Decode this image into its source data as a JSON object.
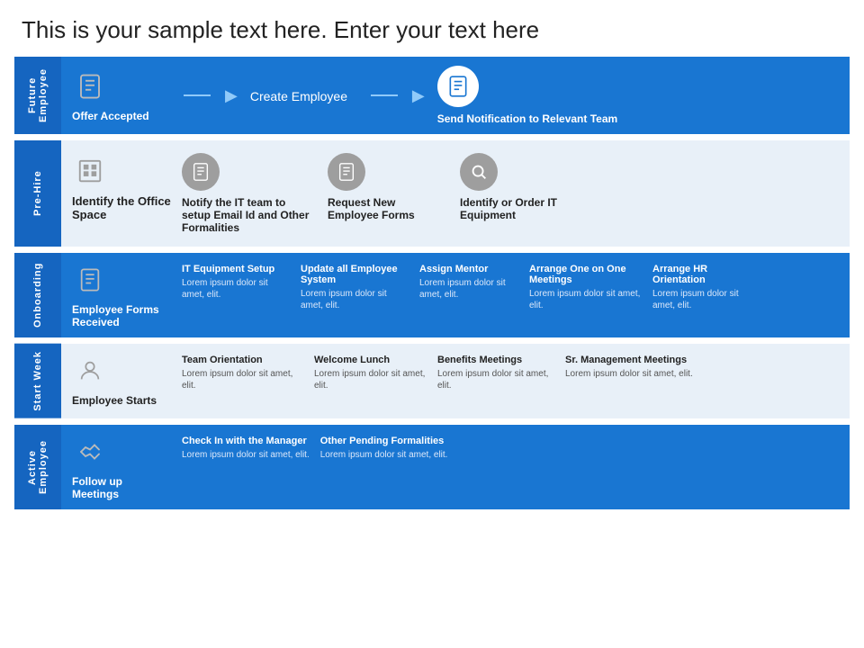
{
  "title": "This is your sample text here. Enter your text here",
  "rows": [
    {
      "id": "future-employee",
      "label": "Future Employee",
      "theme": "blue",
      "cells": [
        {
          "icon": "doc",
          "iconStyle": "plain-white",
          "title": "Offer Accepted",
          "titleStyle": "white",
          "body": ""
        },
        {
          "separator": "arrow-line"
        },
        {
          "icon": null,
          "iconStyle": null,
          "title": "Create Employee",
          "titleStyle": "white",
          "body": ""
        },
        {
          "separator": "arrow-line"
        },
        {
          "icon": "doc",
          "iconStyle": "circle-white",
          "title": "Send Notification to Relevant Team",
          "titleStyle": "white",
          "body": ""
        }
      ]
    },
    {
      "id": "pre-hire",
      "label": "Pre-Hire",
      "theme": "light",
      "cells": [
        {
          "icon": "building",
          "iconStyle": "plain-gray",
          "title": "Identify the Office Space",
          "titleStyle": "dark-bold",
          "body": ""
        },
        {
          "icon": "doc",
          "iconStyle": "circle-gray",
          "title": "Notify the IT team to setup Email Id and Other Formalities",
          "titleStyle": "dark",
          "body": ""
        },
        {
          "icon": "doc",
          "iconStyle": "circle-gray",
          "title": "Request New Employee Forms",
          "titleStyle": "dark",
          "body": ""
        },
        {
          "icon": "search",
          "iconStyle": "circle-gray",
          "title": "Identify or Order IT Equipment",
          "titleStyle": "dark",
          "body": ""
        }
      ]
    },
    {
      "id": "onboarding",
      "label": "Onboarding",
      "theme": "blue",
      "cells": [
        {
          "icon": "doc",
          "iconStyle": "plain-white",
          "title": "Employee Forms Received",
          "titleStyle": "white-bold",
          "body": ""
        },
        {
          "icon": null,
          "iconStyle": null,
          "title": "IT Equipment Setup",
          "titleStyle": "white-bold",
          "body": "Lorem ipsum dolor sit amet, elit."
        },
        {
          "icon": null,
          "iconStyle": null,
          "title": "Update all Employee System",
          "titleStyle": "white-bold",
          "body": "Lorem ipsum dolor sit amet, elit."
        },
        {
          "icon": null,
          "iconStyle": null,
          "title": "Assign Mentor",
          "titleStyle": "white-bold",
          "body": "Lorem ipsum dolor sit amet, elit."
        },
        {
          "icon": null,
          "iconStyle": null,
          "title": "Arrange One on One Meetings",
          "titleStyle": "white-bold",
          "body": "Lorem ipsum dolor sit amet, elit."
        },
        {
          "icon": null,
          "iconStyle": null,
          "title": "Arrange HR Orientation",
          "titleStyle": "white-bold",
          "body": "Lorem ipsum dolor sit amet, elit."
        }
      ]
    },
    {
      "id": "start-week",
      "label": "Start Week",
      "theme": "light",
      "cells": [
        {
          "icon": "person",
          "iconStyle": "plain-gray",
          "title": "Employee Starts",
          "titleStyle": "dark-bold",
          "body": ""
        },
        {
          "icon": null,
          "iconStyle": null,
          "title": "Team Orientation",
          "titleStyle": "dark-bold",
          "body": "Lorem ipsum dolor sit amet, elit."
        },
        {
          "icon": null,
          "iconStyle": null,
          "title": "Welcome Lunch",
          "titleStyle": "dark-bold",
          "body": "Lorem ipsum dolor sit amet, elit."
        },
        {
          "icon": null,
          "iconStyle": null,
          "title": "Benefits Meetings",
          "titleStyle": "dark-bold",
          "body": "Lorem ipsum dolor sit amet, elit."
        },
        {
          "icon": null,
          "iconStyle": null,
          "title": "Sr. Management Meetings",
          "titleStyle": "dark-bold",
          "body": "Lorem ipsum dolor sit amet, elit."
        }
      ]
    },
    {
      "id": "active-employee",
      "label": "Active Employee",
      "theme": "blue",
      "cells": [
        {
          "icon": "handshake",
          "iconStyle": "plain-white",
          "title": "Follow up Meetings",
          "titleStyle": "white-bold",
          "body": ""
        },
        {
          "icon": null,
          "iconStyle": null,
          "title": "Check In with the Manager",
          "titleStyle": "white-bold",
          "body": "Lorem ipsum dolor sit amet, elit."
        },
        {
          "icon": null,
          "iconStyle": null,
          "title": "Other Pending Formalities",
          "titleStyle": "white-bold",
          "body": "Lorem ipsum dolor sit amet, elit."
        }
      ]
    }
  ]
}
